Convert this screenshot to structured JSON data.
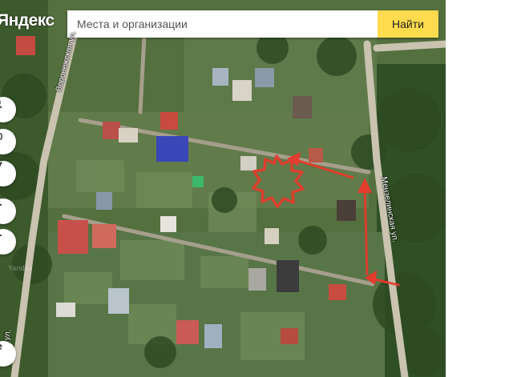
{
  "header": {
    "logo_text": "Яндекс",
    "search_placeholder": "Места и организации",
    "search_button": "Найти"
  },
  "map": {
    "type": "satellite",
    "streets": {
      "west": "Воронежская ул.",
      "east": "Мензелинская ул.",
      "bottom_left": "ул."
    },
    "watermark": "Yandex",
    "annotation_color": "#e8392b"
  },
  "controls": [
    {
      "name": "ruler-icon",
      "action": "ruler"
    },
    {
      "name": "route-icon",
      "action": "routes"
    },
    {
      "name": "locate-icon",
      "action": "my-location"
    },
    {
      "name": "zoom-in-icon",
      "action": "zoom-in"
    },
    {
      "name": "zoom-out-icon",
      "action": "zoom-out"
    },
    {
      "name": "layers-icon",
      "action": "layers"
    }
  ]
}
